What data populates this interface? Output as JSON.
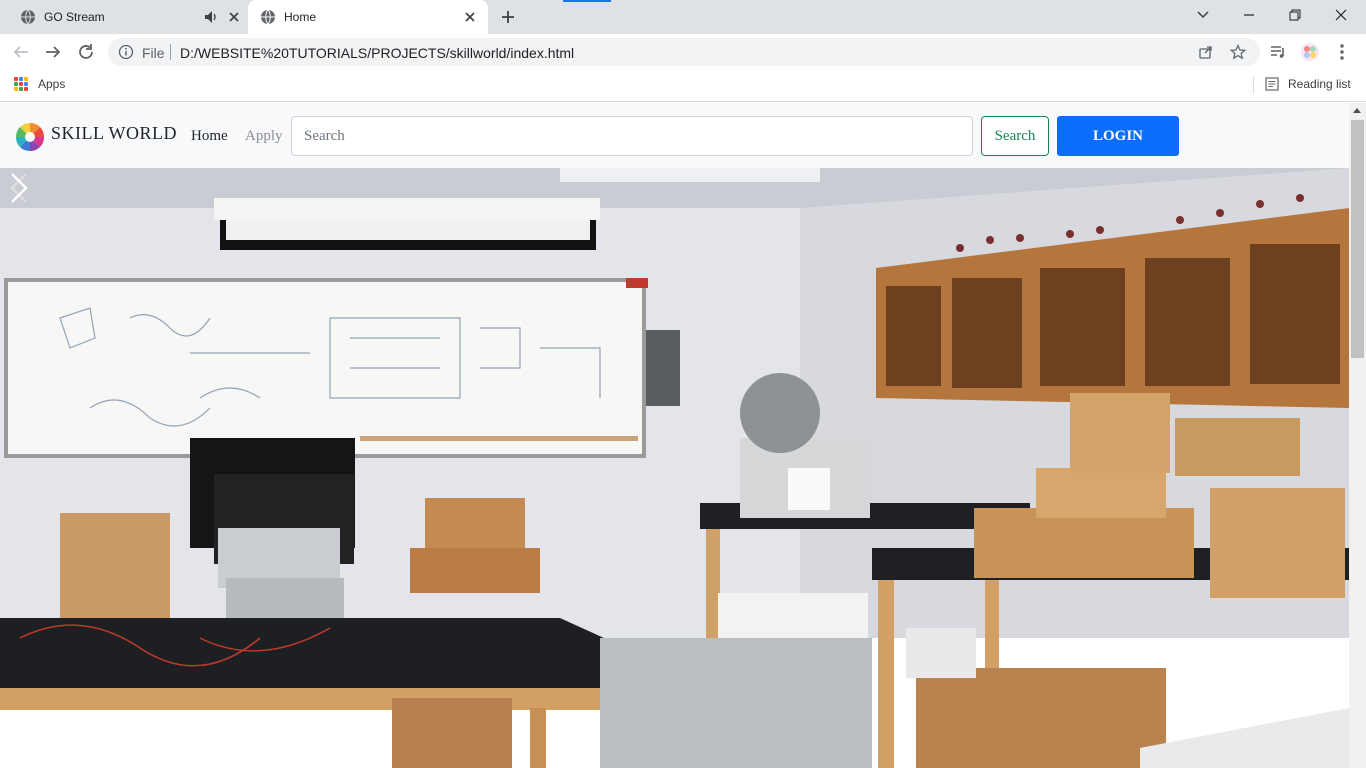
{
  "browser": {
    "tabs": [
      {
        "title": "GO Stream",
        "active": false,
        "audio": true
      },
      {
        "title": "Home",
        "active": true,
        "audio": false
      }
    ],
    "omnibox": {
      "scheme_label": "File",
      "url": "D:/WEBSITE%20TUTORIALS/PROJECTS/skillworld/index.html"
    },
    "bookmarks": {
      "apps_label": "Apps",
      "reading_list_label": "Reading list"
    },
    "accent": "#1a73e8"
  },
  "site": {
    "brand": "SKILL WORLD",
    "nav": {
      "home": "Home",
      "apply": "Apply"
    },
    "search": {
      "placeholder": "Search",
      "button": "Search"
    },
    "login": "LOGIN",
    "colors": {
      "login_bg": "#0d6efd",
      "search_btn": "#198754",
      "navbar_bg": "#f8f9fa"
    },
    "hero": {
      "image": "electronics-lab-photo"
    }
  }
}
